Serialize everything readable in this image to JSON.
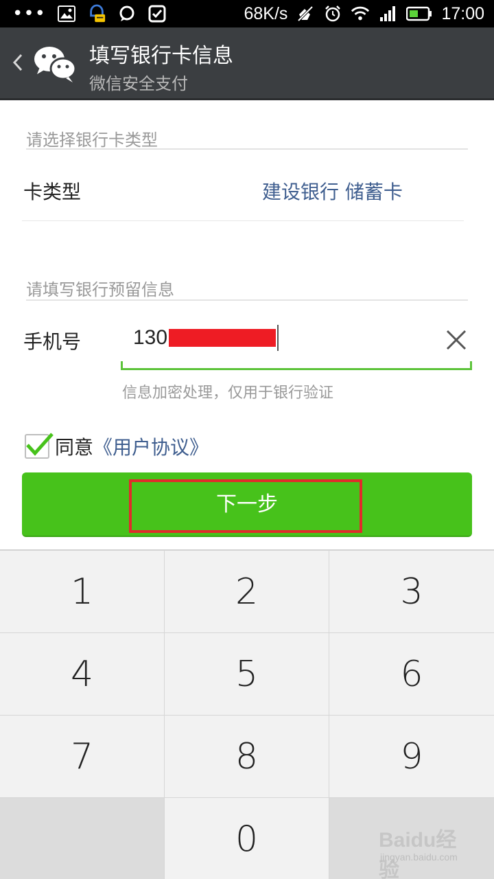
{
  "status_bar": {
    "net_speed": "68K/s",
    "time": "17:00",
    "icons": [
      "more-dots-icon",
      "image-icon",
      "qq-icon",
      "chat-icon",
      "check-icon",
      "mute-icon",
      "alarm-icon",
      "wifi-icon",
      "signal-icon",
      "battery-icon"
    ]
  },
  "header": {
    "title": "填写银行卡信息",
    "subtitle": "微信安全支付"
  },
  "card_section": {
    "hint": "请选择银行卡类型",
    "label": "卡类型",
    "value": "建设银行 储蓄卡"
  },
  "phone_section": {
    "hint": "请填写银行预留信息",
    "label": "手机号",
    "value_prefix": "130",
    "note": "信息加密处理，仅用于银行验证"
  },
  "agreement": {
    "checked": true,
    "text": "同意",
    "link": "《用户协议》"
  },
  "next_button": {
    "label": "下一步"
  },
  "keypad": {
    "keys": [
      "1",
      "2",
      "3",
      "4",
      "5",
      "6",
      "7",
      "8",
      "9",
      "",
      "0",
      ""
    ]
  },
  "watermark": {
    "main": "Baidu经验",
    "sub": "jingyan.baidu.com"
  },
  "colors": {
    "accent_green": "#47c21b",
    "link_blue": "#3f5e8f",
    "titlebar": "#3b3e41",
    "highlight_red": "#e12b2b"
  }
}
